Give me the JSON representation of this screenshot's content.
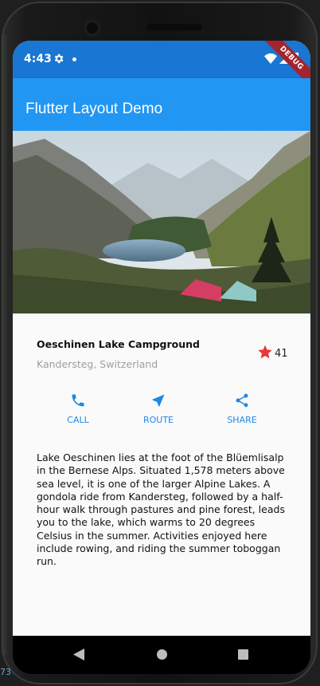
{
  "status_bar": {
    "time": "4:43"
  },
  "debug_banner": {
    "label": "DEBUG"
  },
  "app_bar": {
    "title": "Flutter Layout Demo"
  },
  "hero_image": {
    "description_icon": "mountain-lake-campground-photo"
  },
  "title_section": {
    "name": "Oeschinen Lake Campground",
    "location": "Kandersteg, Switzerland",
    "favorite_count": "41"
  },
  "actions": [
    {
      "label": "CALL",
      "icon": "phone-icon"
    },
    {
      "label": "ROUTE",
      "icon": "navigation-icon"
    },
    {
      "label": "SHARE",
      "icon": "share-icon"
    }
  ],
  "description": "Lake Oeschinen lies at the foot of the Blüemlisalp in the Bernese Alps. Situated 1,578 meters above sea level, it is one of the larger Alpine Lakes. A gondola ride from Kandersteg, followed by a half-hour walk through pastures and pine forest, leads you to the lake, which warms to 20 degrees Celsius in the summer. Activities enjoyed here include rowing, and riding the summer toboggan run.",
  "colors": {
    "primary": "#2196f3",
    "status_bar": "#1976d2",
    "accent_action": "#1e88e5",
    "star": "#e53935"
  },
  "side_label": "73"
}
